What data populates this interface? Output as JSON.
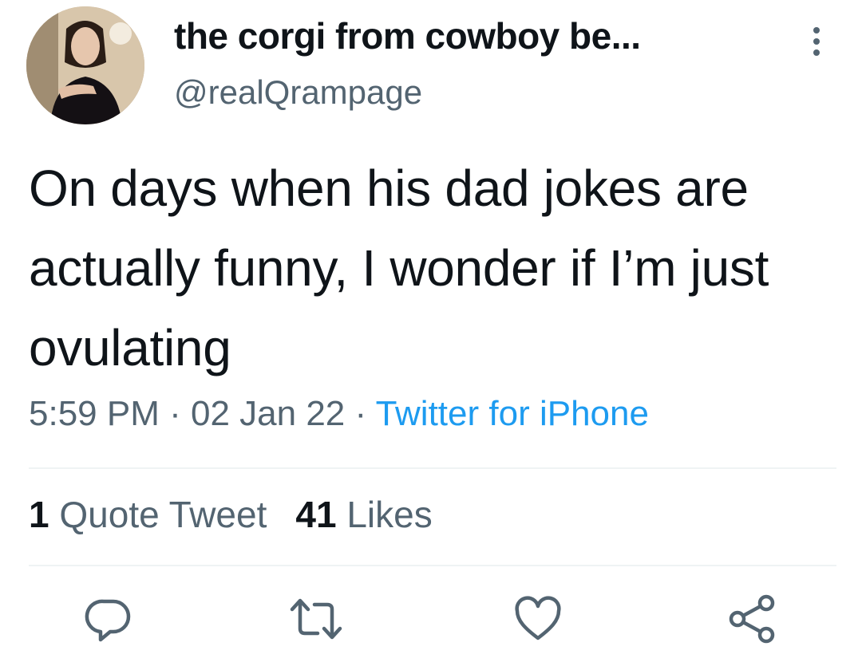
{
  "tweet": {
    "author": {
      "display_name": "the corgi from cowboy be...",
      "handle": "@realQrampage"
    },
    "text": "On days when his dad jokes are actually funny, I wonder if I’m just ovulating",
    "meta": {
      "time": "5:59 PM",
      "separator": " · ",
      "date": "02 Jan 22",
      "source": "Twitter for iPhone"
    },
    "stats": {
      "quote_count": "1",
      "quote_label": "Quote Tweet",
      "like_count": "41",
      "like_label": "Likes"
    }
  },
  "icons": {
    "more": "more-vertical-icon",
    "reply": "reply-icon",
    "retweet": "retweet-icon",
    "like": "heart-icon",
    "share": "share-icon"
  },
  "colors": {
    "text": "#0f1419",
    "secondary": "#536471",
    "link": "#1d9bf0",
    "divider": "#eff3f4"
  }
}
